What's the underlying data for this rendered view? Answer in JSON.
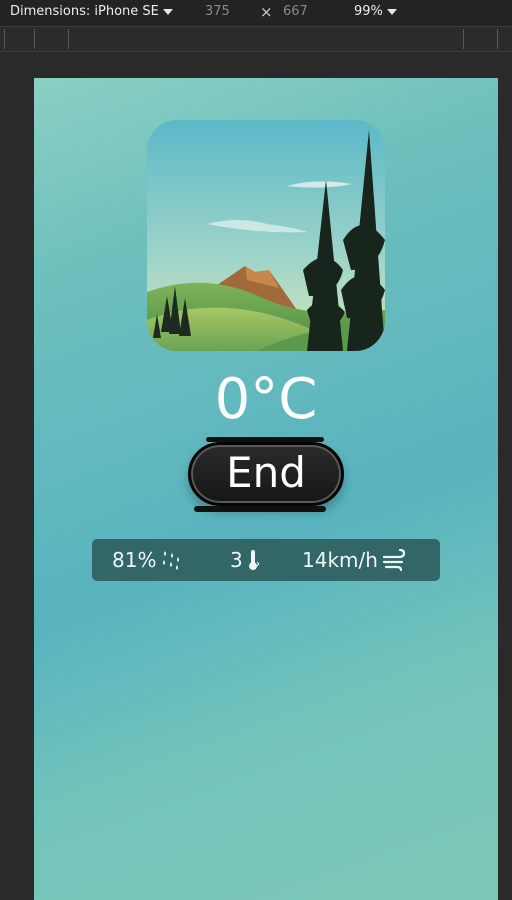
{
  "devtools": {
    "device_label": "Dimensions: iPhone SE",
    "width": "375",
    "times": "×",
    "height": "667",
    "zoom": "99%"
  },
  "weather": {
    "temperature": "0°C",
    "condition_button": "End",
    "humidity": "81%",
    "temp_value": "3",
    "wind": "14km/h"
  },
  "icons": {
    "humidity": "humidity-drops-icon",
    "thermometer": "thermometer-icon",
    "wind": "wind-icon"
  },
  "colors": {
    "bg_start": "#8ccfc4",
    "bg_mid": "#58b3bf",
    "stats_bg": "#2f5e5e",
    "button_bg": "#1c1c1c"
  }
}
